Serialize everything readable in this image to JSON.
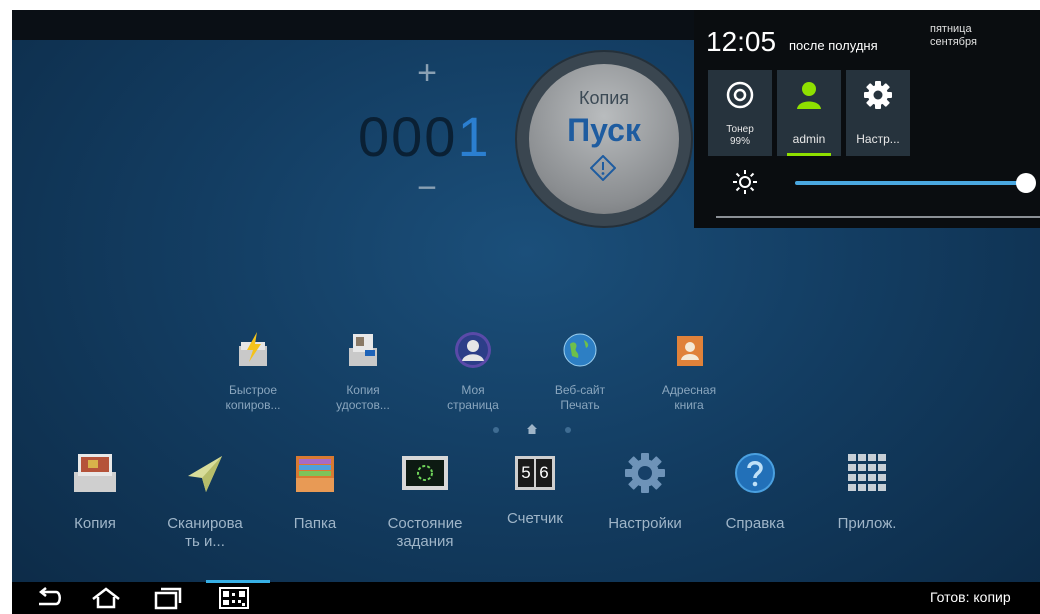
{
  "counter": {
    "plus": "+",
    "value": "000",
    "last_digit": "1",
    "minus": "−"
  },
  "start": {
    "caption": "Копия",
    "label": "Пуск"
  },
  "panel": {
    "time": "12:05",
    "ampm": "после полудня",
    "day": "пятница",
    "month": "сентября",
    "tiles": [
      {
        "label": "Тонер\n99%",
        "icon": "toner-icon"
      },
      {
        "label": "admin",
        "icon": "user-icon"
      },
      {
        "label": "Настр...",
        "icon": "gear-icon"
      }
    ],
    "brightness": 0.95
  },
  "favorites": [
    {
      "label": "Быстрое\nкопиров...",
      "icon": "quick-copy-icon"
    },
    {
      "label": "Копия\nудостов...",
      "icon": "id-copy-icon"
    },
    {
      "label": "Моя\nстраница",
      "icon": "my-page-icon"
    },
    {
      "label": "Веб-сайт\nПечать",
      "icon": "web-print-icon"
    },
    {
      "label": "Адресная\nкнига",
      "icon": "address-book-icon"
    }
  ],
  "dock": [
    {
      "label": "Копия",
      "icon": "copy-icon"
    },
    {
      "label": "Сканирова\nть и...",
      "icon": "scan-icon"
    },
    {
      "label": "Папка",
      "icon": "folder-icon"
    },
    {
      "label": "Состояние\nзадания",
      "icon": "job-status-icon"
    },
    {
      "label": "Счетчик",
      "icon": "counter-icon"
    },
    {
      "label": "Настройки",
      "icon": "settings-icon"
    },
    {
      "label": "Справка",
      "icon": "help-icon"
    },
    {
      "label": "Прилож.",
      "icon": "apps-icon"
    }
  ],
  "counter_tiles": [
    "5",
    "6"
  ],
  "navbar": {
    "status": "Готов: копир"
  },
  "colors": {
    "accent_green": "#8fe000",
    "slider_blue": "#4aa8e0",
    "nav_accent": "#37b0e6"
  }
}
